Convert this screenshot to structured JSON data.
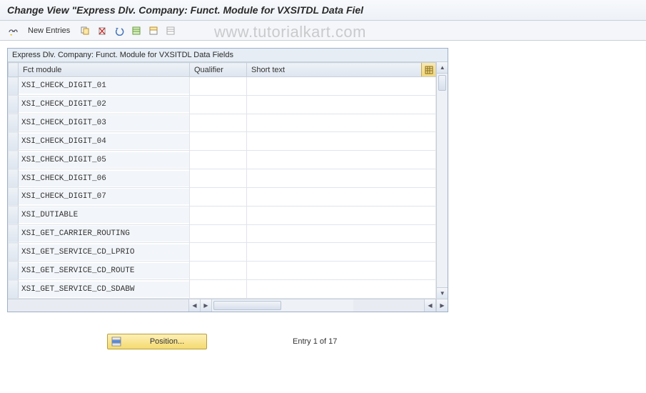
{
  "title": "Change View \"Express Dlv. Company: Funct. Module for VXSITDL Data Fiel",
  "toolbar": {
    "new_entries_label": "New Entries"
  },
  "watermark": "www.tutorialkart.com",
  "table": {
    "caption": "Express Dlv. Company: Funct. Module for VXSITDL Data Fields",
    "columns": {
      "fct_module": "Fct module",
      "qualifier": "Qualifier",
      "short_text": "Short text"
    },
    "rows": [
      {
        "fct": "XSI_CHECK_DIGIT_01",
        "qual": "",
        "text": ""
      },
      {
        "fct": "XSI_CHECK_DIGIT_02",
        "qual": "",
        "text": ""
      },
      {
        "fct": "XSI_CHECK_DIGIT_03",
        "qual": "",
        "text": ""
      },
      {
        "fct": "XSI_CHECK_DIGIT_04",
        "qual": "",
        "text": ""
      },
      {
        "fct": "XSI_CHECK_DIGIT_05",
        "qual": "",
        "text": ""
      },
      {
        "fct": "XSI_CHECK_DIGIT_06",
        "qual": "",
        "text": ""
      },
      {
        "fct": "XSI_CHECK_DIGIT_07",
        "qual": "",
        "text": ""
      },
      {
        "fct": "XSI_DUTIABLE",
        "qual": "",
        "text": ""
      },
      {
        "fct": "XSI_GET_CARRIER_ROUTING",
        "qual": "",
        "text": ""
      },
      {
        "fct": "XSI_GET_SERVICE_CD_LPRIO",
        "qual": "",
        "text": ""
      },
      {
        "fct": "XSI_GET_SERVICE_CD_ROUTE",
        "qual": "",
        "text": ""
      },
      {
        "fct": "XSI_GET_SERVICE_CD_SDABW",
        "qual": "",
        "text": ""
      }
    ]
  },
  "footer": {
    "position_label": "Position...",
    "entry_text": "Entry 1 of 17"
  }
}
